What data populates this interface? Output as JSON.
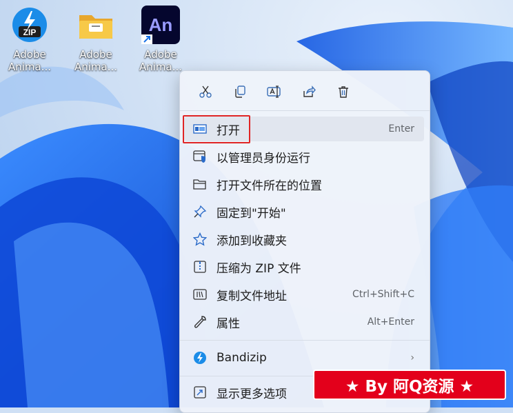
{
  "desktop": {
    "icons": [
      {
        "label_line1": "Adobe",
        "label_line2": "Anima...",
        "icon": "zip-archive-icon"
      },
      {
        "label_line1": "Adobe",
        "label_line2": "Anima...",
        "icon": "folder-icon"
      },
      {
        "label_line1": "Adobe",
        "label_line2": "Anima...",
        "icon": "adobe-animate-icon",
        "glyph_text": "An"
      }
    ]
  },
  "menu": {
    "quick_actions": [
      "cut-icon",
      "copy-icon",
      "rename-icon",
      "share-icon",
      "delete-icon"
    ],
    "items": [
      {
        "label": "打开",
        "shortcut": "Enter",
        "icon": "app-window-icon"
      },
      {
        "label": "以管理员身份运行",
        "shortcut": "",
        "icon": "admin-shield-icon"
      },
      {
        "label": "打开文件所在的位置",
        "shortcut": "",
        "icon": "folder-open-icon"
      },
      {
        "label": "固定到\"开始\"",
        "shortcut": "",
        "icon": "pin-icon"
      },
      {
        "label": "添加到收藏夹",
        "shortcut": "",
        "icon": "star-icon"
      },
      {
        "label": "压缩为 ZIP 文件",
        "shortcut": "",
        "icon": "zip-folder-icon"
      },
      {
        "label": "复制文件地址",
        "shortcut": "Ctrl+Shift+C",
        "icon": "copy-path-icon"
      },
      {
        "label": "属性",
        "shortcut": "Alt+Enter",
        "icon": "wrench-icon"
      },
      {
        "label": "Bandizip",
        "shortcut": "",
        "icon": "bandizip-icon",
        "submenu": "›"
      },
      {
        "label": "显示更多选项",
        "shortcut": "",
        "icon": "more-options-icon"
      }
    ]
  },
  "watermark": {
    "text": "★ By 阿Q资源 ★"
  },
  "colors": {
    "accent": "#1a73e8",
    "highlight": "#e02424",
    "watermark_bg": "#e3001b"
  }
}
